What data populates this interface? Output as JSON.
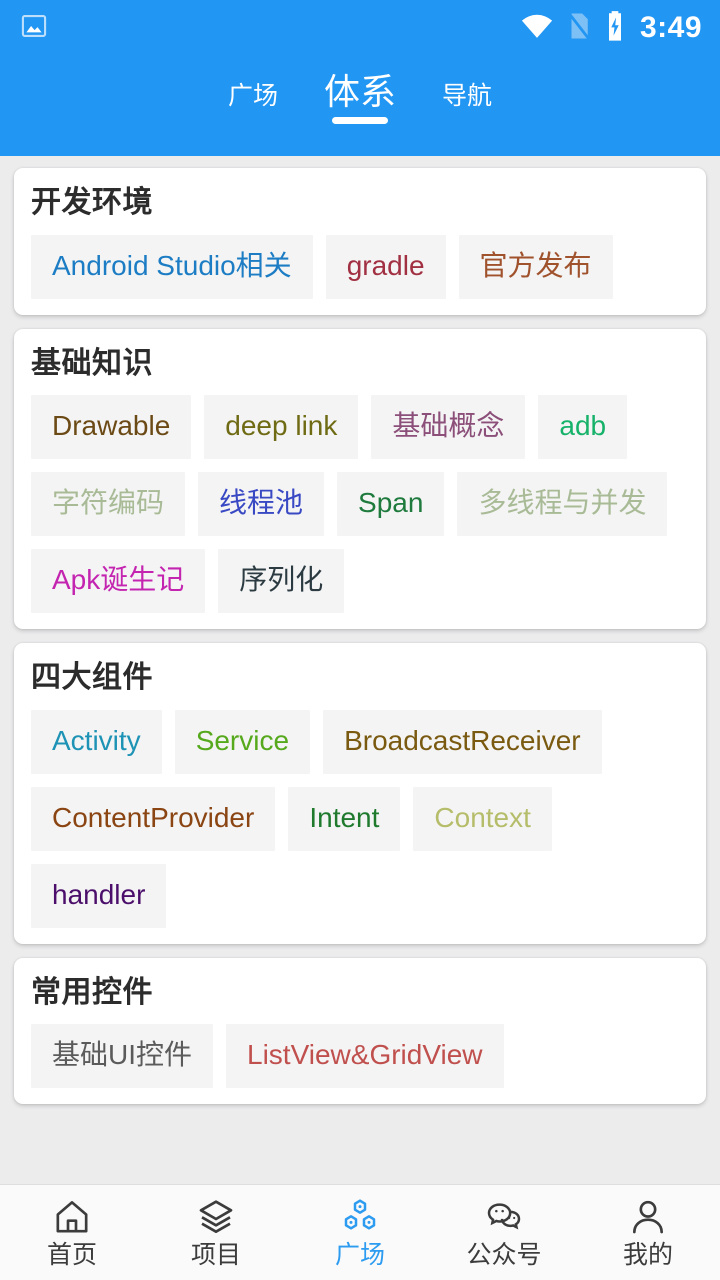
{
  "status_bar": {
    "notification_icon": "image-notification-icon",
    "wifi_icon": "wifi-icon",
    "sim_icon": "sim-card-off-icon",
    "battery_icon": "battery-charging-icon",
    "time": "3:49"
  },
  "top_tabs": {
    "items": [
      {
        "label": "广场",
        "active": false
      },
      {
        "label": "体系",
        "active": true
      },
      {
        "label": "导航",
        "active": false
      }
    ]
  },
  "theme": {
    "primary": "#2196f3",
    "page_background": "#ececed",
    "card_background": "#ffffff",
    "tag_background": "#f4f4f4",
    "accent": "#2d9cf0"
  },
  "cards": [
    {
      "title": "开发环境",
      "tags": [
        {
          "label": "Android Studio相关",
          "color": "#1d7dc4"
        },
        {
          "label": "gradle",
          "color": "#a13042"
        },
        {
          "label": "官方发布",
          "color": "#a0522d"
        }
      ]
    },
    {
      "title": "基础知识",
      "tags": [
        {
          "label": "Drawable",
          "color": "#6b4a15"
        },
        {
          "label": "deep link",
          "color": "#6f6b14"
        },
        {
          "label": "基础概念",
          "color": "#8b4f7a"
        },
        {
          "label": "adb",
          "color": "#17b26a"
        },
        {
          "label": "字符编码",
          "color": "#a8bb96"
        },
        {
          "label": "线程池",
          "color": "#3949c4"
        },
        {
          "label": "Span",
          "color": "#1f7a3d"
        },
        {
          "label": "多线程与并发",
          "color": "#a8bb96"
        },
        {
          "label": "Apk诞生记",
          "color": "#c425b0"
        },
        {
          "label": "序列化",
          "color": "#2c3b42"
        }
      ]
    },
    {
      "title": "四大组件",
      "tags": [
        {
          "label": "Activity",
          "color": "#1e93b5"
        },
        {
          "label": "Service",
          "color": "#56a91c"
        },
        {
          "label": "BroadcastReceiver",
          "color": "#7a5a11"
        },
        {
          "label": "ContentProvider",
          "color": "#8a4513"
        },
        {
          "label": "Intent",
          "color": "#1f7a2e"
        },
        {
          "label": "Context",
          "color": "#b6bd6a"
        },
        {
          "label": "handler",
          "color": "#4b0f6b"
        }
      ]
    },
    {
      "title": "常用控件",
      "tags": [
        {
          "label": "基础UI控件",
          "color": "#5b5b5b"
        },
        {
          "label": "ListView&GridView",
          "color": "#c0504d"
        }
      ]
    }
  ],
  "bottom_nav": {
    "items": [
      {
        "label": "首页",
        "icon": "home-icon",
        "active": false
      },
      {
        "label": "项目",
        "icon": "layers-icon",
        "active": false
      },
      {
        "label": "广场",
        "icon": "hexagon-nodes-icon",
        "active": true
      },
      {
        "label": "公众号",
        "icon": "chat-bubbles-icon",
        "active": false
      },
      {
        "label": "我的",
        "icon": "person-icon",
        "active": false
      }
    ]
  }
}
